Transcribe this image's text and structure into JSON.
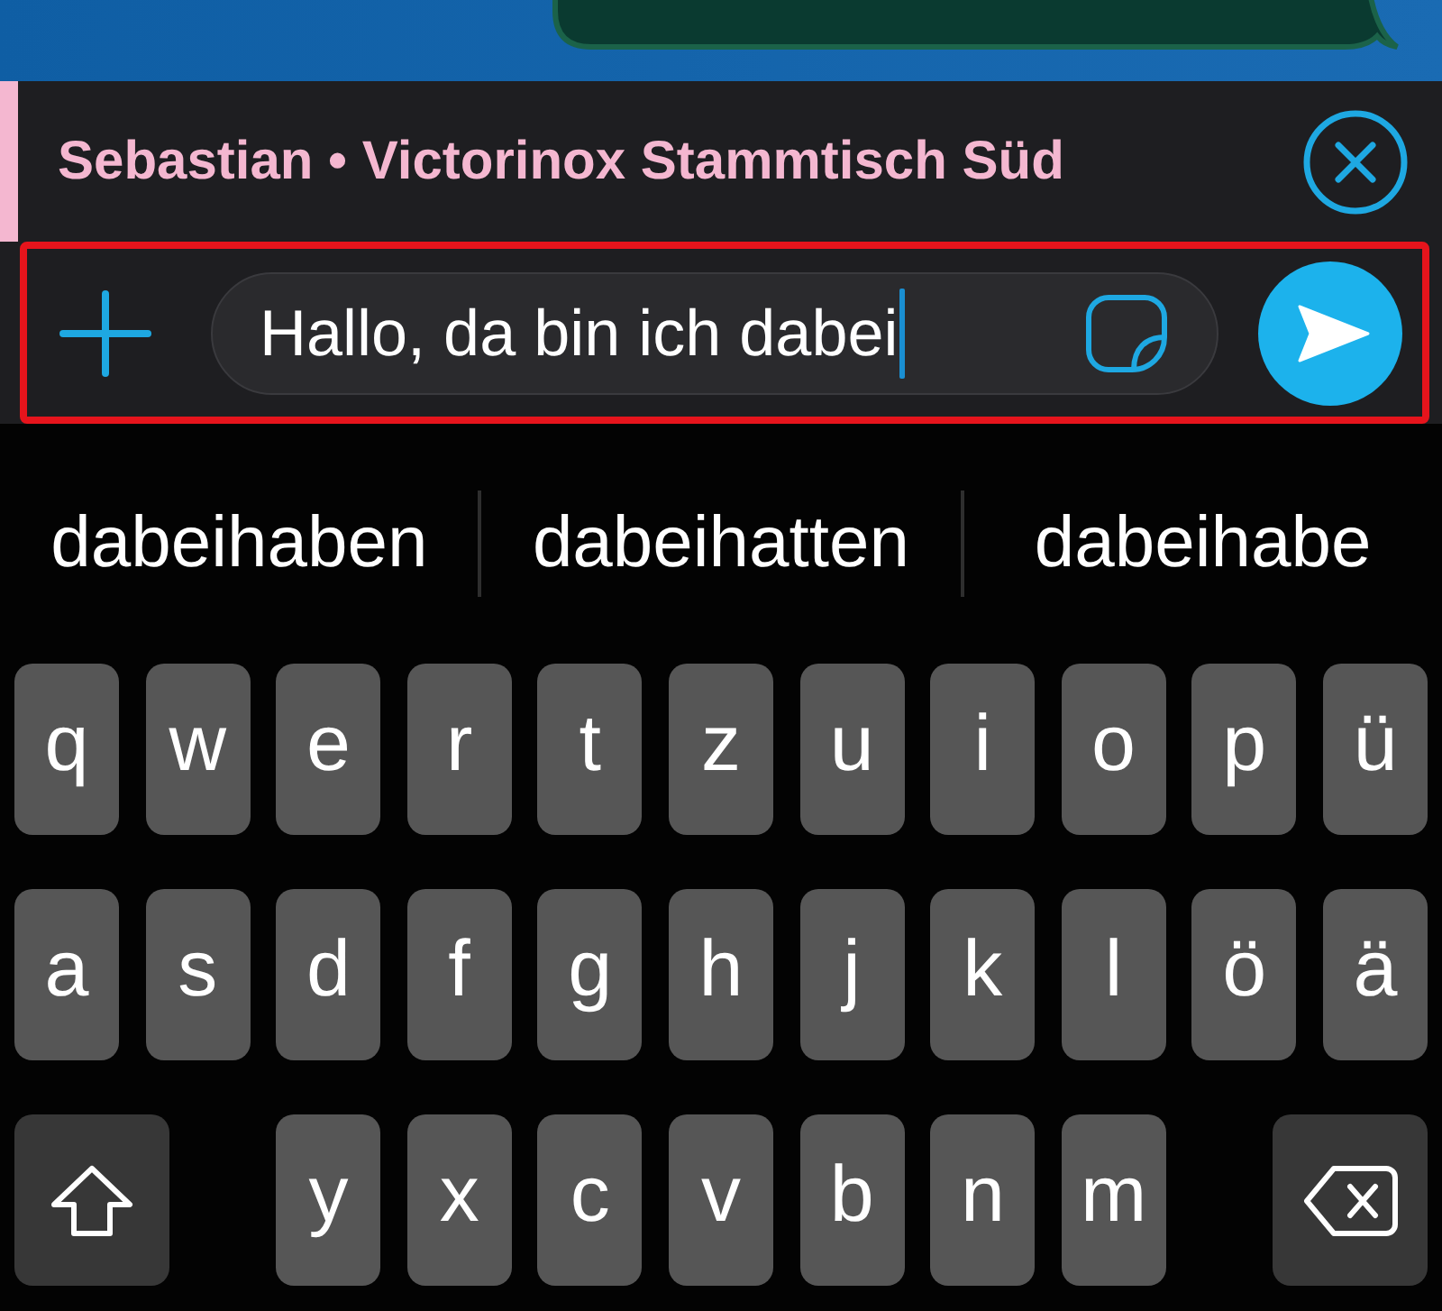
{
  "reply_bar": {
    "text": "Sebastian • Victorinox Stammtisch Süd"
  },
  "composer": {
    "value": "Hallo, da bin ich dabei",
    "focused": true,
    "highlighted": true
  },
  "suggestions": [
    "dabeihaben",
    "dabeihatten",
    "dabeihabe"
  ],
  "keyboard": {
    "rows": [
      [
        {
          "kind": "letter",
          "label": "q"
        },
        {
          "kind": "letter",
          "label": "w"
        },
        {
          "kind": "letter",
          "label": "e"
        },
        {
          "kind": "letter",
          "label": "r"
        },
        {
          "kind": "letter",
          "label": "t"
        },
        {
          "kind": "letter",
          "label": "z"
        },
        {
          "kind": "letter",
          "label": "u"
        },
        {
          "kind": "letter",
          "label": "i"
        },
        {
          "kind": "letter",
          "label": "o"
        },
        {
          "kind": "letter",
          "label": "p"
        },
        {
          "kind": "letter",
          "label": "ü"
        }
      ],
      [
        {
          "kind": "letter",
          "label": "a"
        },
        {
          "kind": "letter",
          "label": "s"
        },
        {
          "kind": "letter",
          "label": "d"
        },
        {
          "kind": "letter",
          "label": "f"
        },
        {
          "kind": "letter",
          "label": "g"
        },
        {
          "kind": "letter",
          "label": "h"
        },
        {
          "kind": "letter",
          "label": "j"
        },
        {
          "kind": "letter",
          "label": "k"
        },
        {
          "kind": "letter",
          "label": "l"
        },
        {
          "kind": "letter",
          "label": "ö"
        },
        {
          "kind": "letter",
          "label": "ä"
        }
      ],
      [
        {
          "kind": "shift"
        },
        "",
        {
          "kind": "letter",
          "label": "y"
        },
        {
          "kind": "letter",
          "label": "x"
        },
        {
          "kind": "letter",
          "label": "c"
        },
        {
          "kind": "letter",
          "label": "v"
        },
        {
          "kind": "letter",
          "label": "b"
        },
        {
          "kind": "letter",
          "label": "n"
        },
        {
          "kind": "letter",
          "label": "m"
        },
        "",
        {
          "kind": "delete"
        }
      ]
    ]
  }
}
